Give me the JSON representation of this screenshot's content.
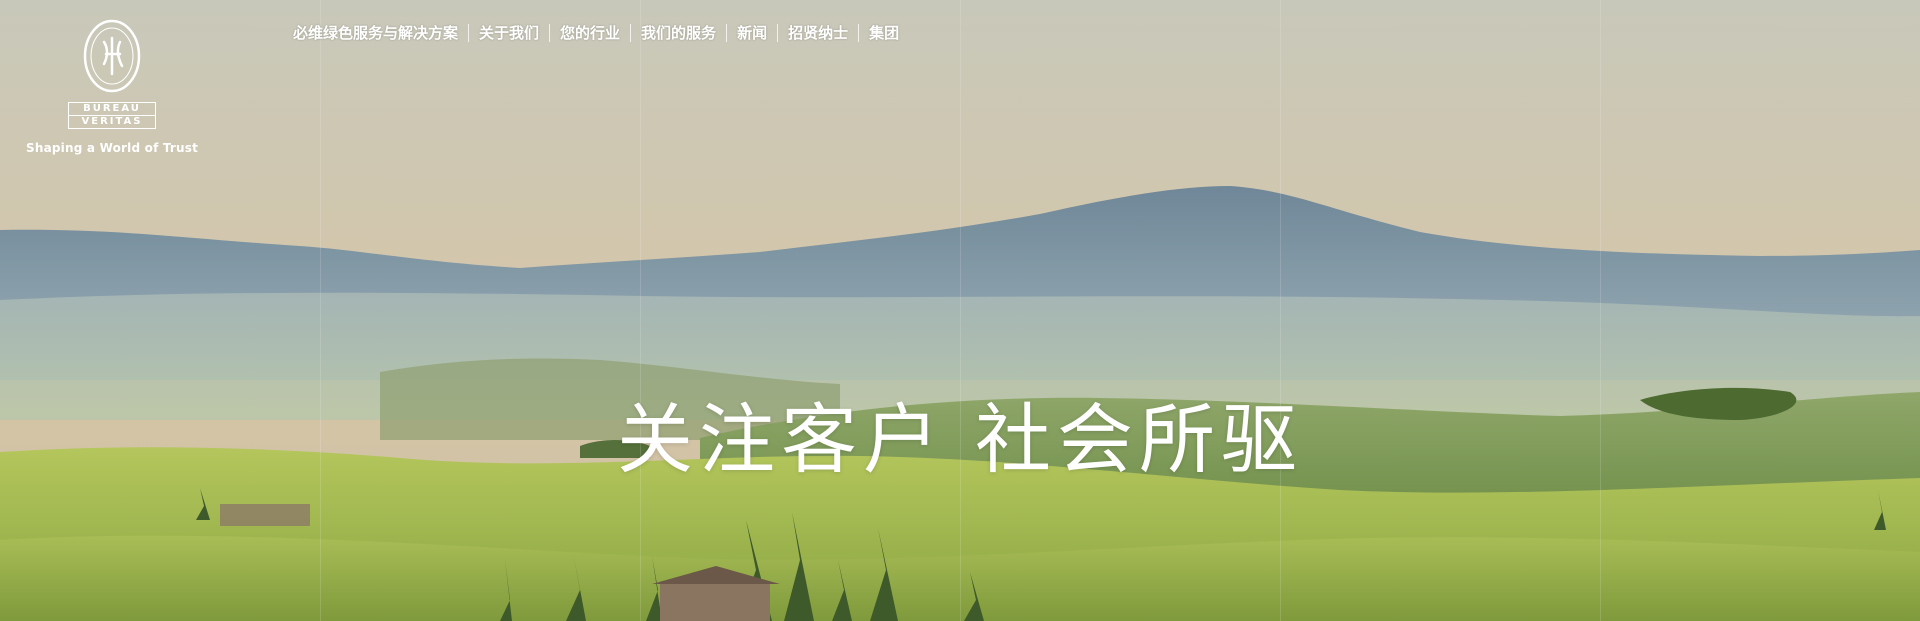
{
  "brand": {
    "logo_top": "BUREAU",
    "logo_bottom": "VERITAS",
    "tagline": "Shaping a World of Trust"
  },
  "nav": {
    "items": [
      "必维绿色服务与解决方案",
      "关于我们",
      "您的行业",
      "我们的服务",
      "新闻",
      "招贤纳士",
      "集团"
    ]
  },
  "hero": {
    "headline_part1": "关注客户",
    "headline_part2": "社会所驱"
  }
}
